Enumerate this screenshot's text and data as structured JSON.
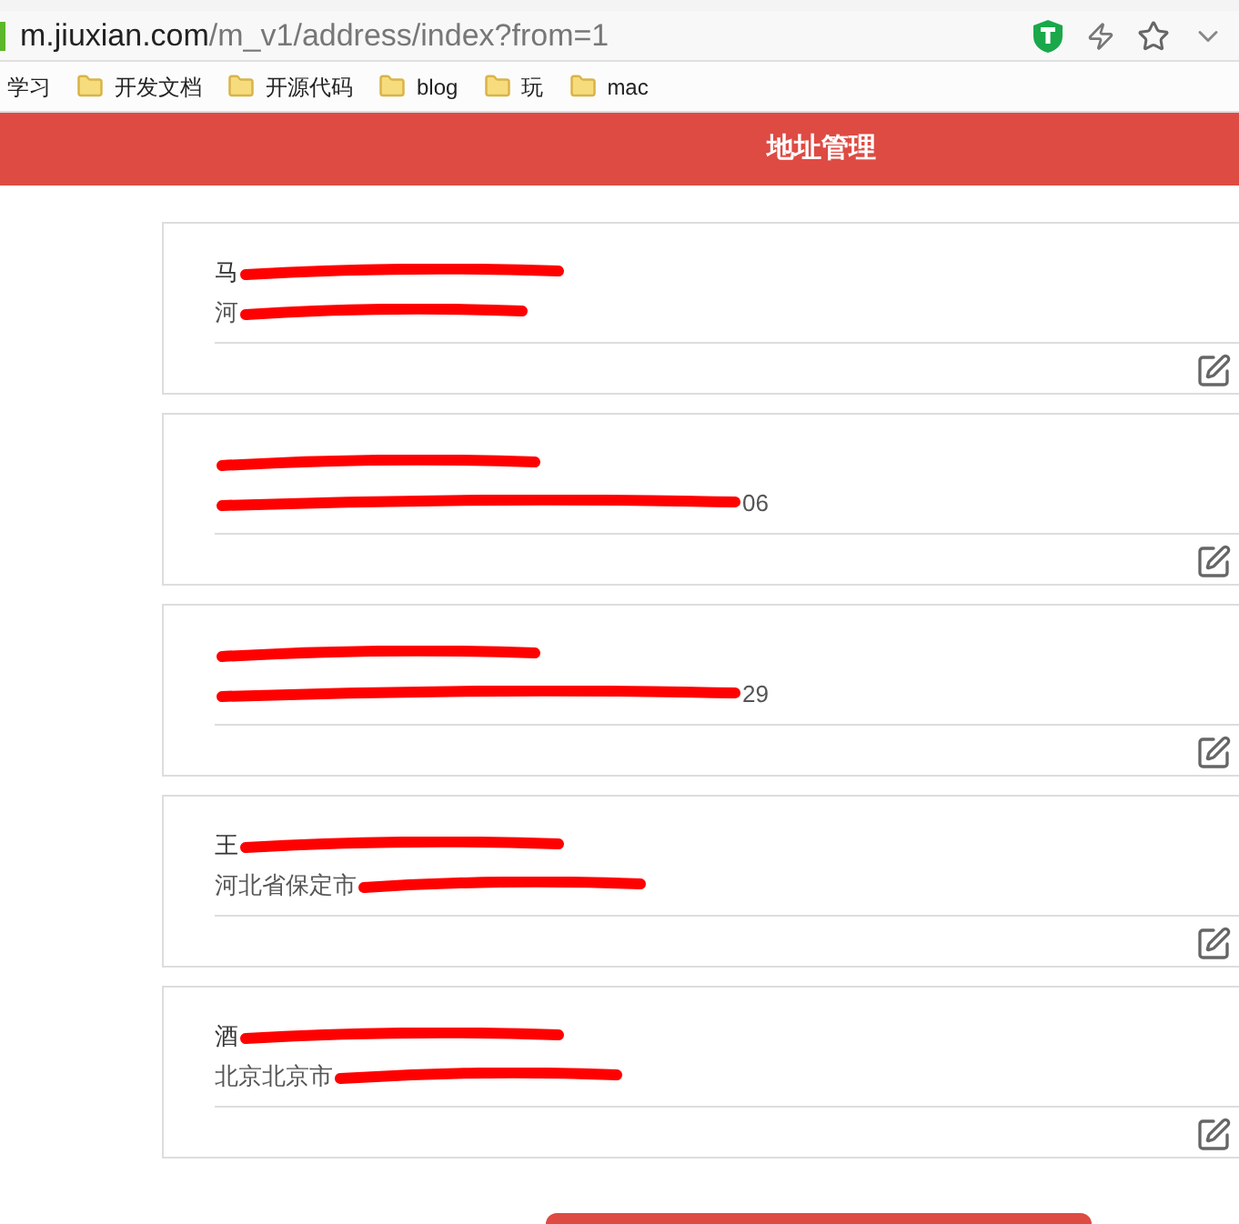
{
  "browser": {
    "url_host": "m.jiuxian.com",
    "url_path": "/m_v1/address/index?from=1",
    "bookmarks": [
      {
        "label": "学习",
        "kind": "plain"
      },
      {
        "label": "开发文档",
        "kind": "folder"
      },
      {
        "label": "开源代码",
        "kind": "folder"
      },
      {
        "label": "blog",
        "kind": "folder"
      },
      {
        "label": "玩",
        "kind": "folder"
      },
      {
        "label": "mac",
        "kind": "folder"
      }
    ]
  },
  "header": {
    "title": "地址管理"
  },
  "addresses": [
    {
      "name": "马",
      "address": "河",
      "redacted": true
    },
    {
      "address_tail": "06",
      "redacted": true
    },
    {
      "address_tail": "29",
      "redacted": true
    },
    {
      "name": "王",
      "address": "河北省保定市",
      "redacted": true
    },
    {
      "name": "酒",
      "address": "北京北京市",
      "redacted": true
    }
  ]
}
